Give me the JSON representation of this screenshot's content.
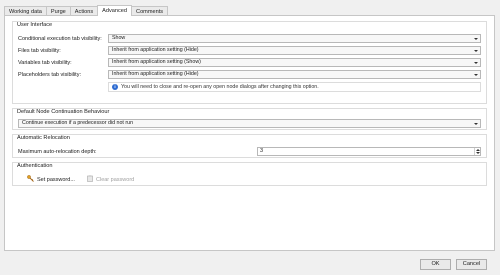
{
  "tabs": [
    "Working data",
    "Purge",
    "Actions",
    "Advanced",
    "Comments"
  ],
  "active_tab": "Advanced",
  "user_interface": {
    "title": "User Interface",
    "rows": [
      {
        "label": "Conditional execution tab visibility:",
        "value": "Show"
      },
      {
        "label": "Files tab visibility:",
        "value": "Inherit from application setting (Hide)"
      },
      {
        "label": "Variables tab visibility:",
        "value": "Inherit from application setting (Show)"
      },
      {
        "label": "Placeholders tab visibility:",
        "value": "Inherit from application setting (Hide)"
      }
    ],
    "info_text": "You will need to close and re-open any open node dialogs after changing this option.",
    "info_icon": "info-icon"
  },
  "continuation": {
    "title": "Default Node Continuation Behaviour",
    "value": "Continue execution if a predecessor did not run"
  },
  "relocation": {
    "title": "Automatic Relocation",
    "label": "Maximum auto-relocation depth:",
    "value": "3"
  },
  "authentication": {
    "title": "Authentication",
    "set_password": "Set password...",
    "set_password_icon": "key-icon",
    "clear_password": "Clear password",
    "clear_password_icon": "clipboard-icon"
  },
  "buttons": {
    "ok": "OK",
    "cancel": "Cancel"
  }
}
